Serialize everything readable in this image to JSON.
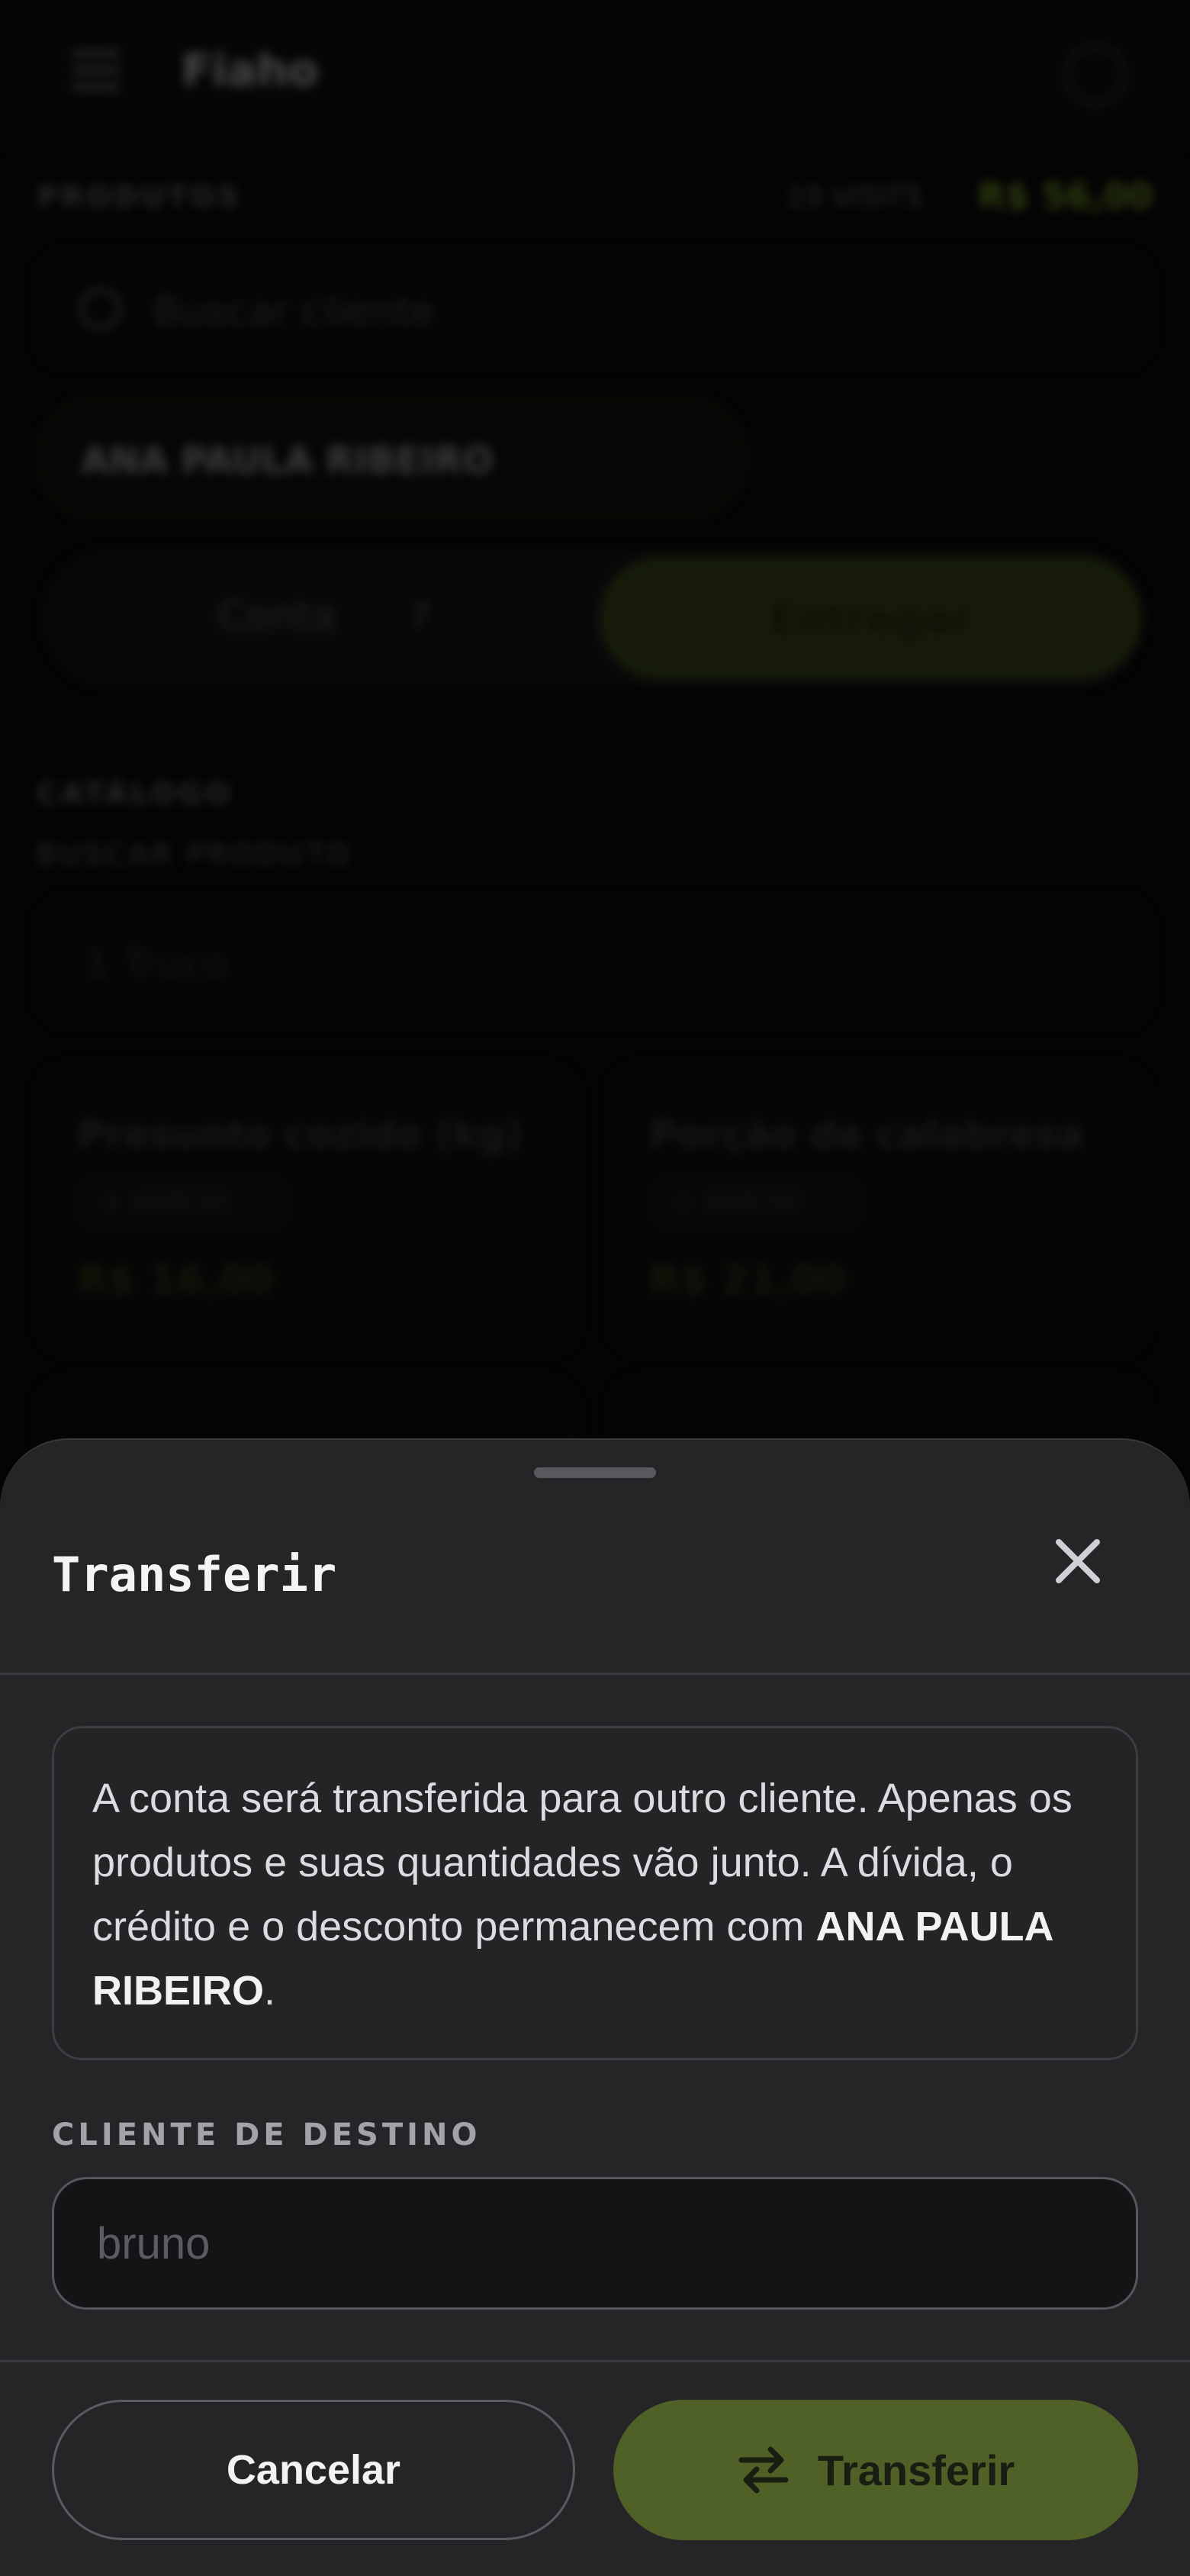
{
  "background": {
    "app_title": "Fiaho",
    "section_products": "PRODUTOS",
    "visits_label": "19 VISITS",
    "visits_value": "R$ 56,00",
    "search_placeholder": "Buscar cliente",
    "client_chip": "ANA PAULA RIBEIRO",
    "toggle_left": "Conta",
    "toggle_left_badge": "7",
    "toggle_right": "Entregar",
    "catalog_label": "CATÁLOGO",
    "catalog_sub": "BUSCAR PRODUTO",
    "product_field_placeholder": "1 Truco",
    "products": [
      {
        "name": "Presunto cozido (kg)",
        "chip": "+ ADICIO",
        "price": "R$ 16,00"
      },
      {
        "name": "Porção de calabresa",
        "chip": "+ ADICIO",
        "price": "R$ 21,00"
      }
    ]
  },
  "sheet": {
    "title": "Transferir",
    "info_text_pre": "A conta será transferida para outro cliente. Apenas os produtos e suas quantidades vão junto. A dívida, o crédito e o desconto permanecem com ",
    "info_client": "ANA PAULA RIBEIRO",
    "info_text_post": ".",
    "dest_label": "CLIENTE DE DESTINO",
    "dest_placeholder": "bruno",
    "cancel_label": "Cancelar",
    "transfer_label": "Transferir"
  },
  "colors": {
    "accent": "#4f6126",
    "sheet_bg": "#252528",
    "brand_green": "#7a9d24"
  },
  "icons": {
    "close": "close-icon",
    "transfer": "swap-arrows-icon",
    "menu": "menu-icon",
    "search": "search-icon"
  }
}
